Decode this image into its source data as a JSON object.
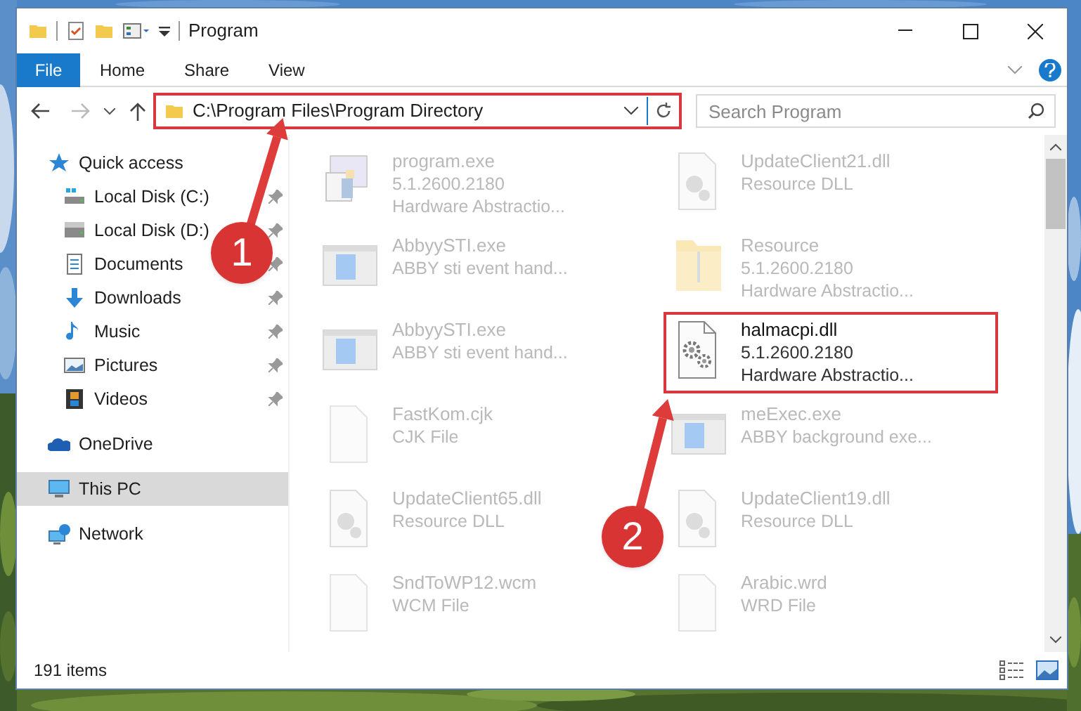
{
  "window": {
    "title": "Program"
  },
  "ribbon": {
    "tabs": [
      {
        "label": "File",
        "kind": "file"
      },
      {
        "label": "Home",
        "kind": "tab"
      },
      {
        "label": "Share",
        "kind": "tab"
      },
      {
        "label": "View",
        "kind": "tab"
      }
    ]
  },
  "address": {
    "path": "C:\\Program Files\\Program Directory",
    "highlighted": true
  },
  "search": {
    "placeholder": "Search Program"
  },
  "sidebar": {
    "items": [
      {
        "label": "Quick access",
        "kind": "star",
        "selected": false,
        "children": [
          {
            "label": "Local Disk (C:)",
            "kind": "disk-c",
            "pinned": true,
            "selected": false
          },
          {
            "label": "Local Disk (D:)",
            "kind": "disk",
            "pinned": true,
            "selected": false
          },
          {
            "label": "Documents",
            "kind": "documents",
            "pinned": true,
            "selected": false
          },
          {
            "label": "Downloads",
            "kind": "downloads",
            "pinned": true,
            "selected": false
          },
          {
            "label": "Music",
            "kind": "music",
            "pinned": true,
            "selected": false
          },
          {
            "label": "Pictures",
            "kind": "pictures",
            "pinned": true,
            "selected": false
          },
          {
            "label": "Videos",
            "kind": "videos",
            "pinned": true,
            "selected": false
          }
        ]
      },
      {
        "label": "OneDrive",
        "kind": "cloud",
        "selected": false
      },
      {
        "label": "This PC",
        "kind": "pc",
        "selected": true
      },
      {
        "label": "Network",
        "kind": "network",
        "selected": false
      }
    ]
  },
  "files": [
    {
      "kind": "program",
      "lines": [
        "program.exe",
        "5.1.2600.2180",
        "Hardware Abstractio..."
      ],
      "faded": true,
      "highlighted": false
    },
    {
      "kind": "dll",
      "lines": [
        "UpdateClient21.dll",
        "Resource DLL"
      ],
      "faded": true,
      "highlighted": false
    },
    {
      "kind": "app",
      "lines": [
        "AbbyySTI.exe",
        "ABBY sti event hand..."
      ],
      "faded": true,
      "highlighted": false
    },
    {
      "kind": "folder",
      "lines": [
        "Resource",
        "5.1.2600.2180",
        "Hardware Abstractio..."
      ],
      "faded": true,
      "highlighted": false
    },
    {
      "kind": "app",
      "lines": [
        "AbbyySTI.exe",
        "ABBY sti event hand..."
      ],
      "faded": true,
      "highlighted": false
    },
    {
      "kind": "gears",
      "lines": [
        "halmacpi.dll",
        "5.1.2600.2180",
        "Hardware Abstractio..."
      ],
      "faded": false,
      "highlighted": true
    },
    {
      "kind": "file",
      "lines": [
        "FastKom.cjk",
        "CJK File"
      ],
      "faded": true,
      "highlighted": false
    },
    {
      "kind": "app",
      "lines": [
        "meExec.exe",
        "ABBY background exe..."
      ],
      "faded": true,
      "highlighted": false
    },
    {
      "kind": "dll",
      "lines": [
        "UpdateClient65.dll",
        "Resource DLL"
      ],
      "faded": true,
      "highlighted": false
    },
    {
      "kind": "dll",
      "lines": [
        "UpdateClient19.dll",
        "Resource DLL"
      ],
      "faded": true,
      "highlighted": false
    },
    {
      "kind": "file",
      "lines": [
        "SndToWP12.wcm",
        "WCM File"
      ],
      "faded": true,
      "highlighted": false
    },
    {
      "kind": "file",
      "lines": [
        "Arabic.wrd",
        "WRD File"
      ],
      "faded": true,
      "highlighted": false
    }
  ],
  "status_bar": {
    "count": "191 items"
  },
  "annotations": [
    {
      "label": "1"
    },
    {
      "label": "2"
    }
  ]
}
